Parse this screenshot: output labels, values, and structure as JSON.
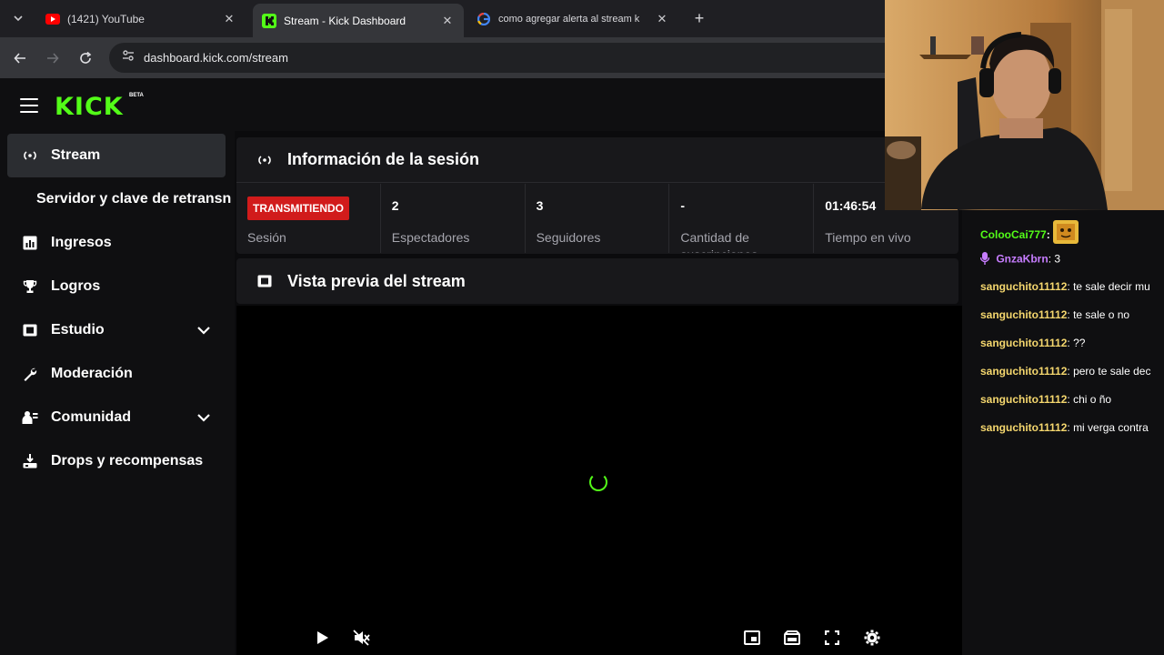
{
  "browser": {
    "tabs": [
      {
        "title": "(1421) YouTube",
        "icon": "youtube-icon",
        "active": false
      },
      {
        "title": "Stream - Kick Dashboard",
        "icon": "kick-icon",
        "active": true
      },
      {
        "title": "como agregar alerta al stream k",
        "icon": "google-icon",
        "active": false
      }
    ],
    "url": "dashboard.kick.com/stream"
  },
  "app": {
    "logo": "KICK",
    "logo_badge": "BETA"
  },
  "sidebar": {
    "items": [
      {
        "label": "Stream",
        "icon": "broadcast-icon"
      },
      {
        "label": "Ingresos",
        "icon": "chart-icon"
      },
      {
        "label": "Logros",
        "icon": "trophy-icon"
      },
      {
        "label": "Estudio",
        "icon": "studio-icon"
      },
      {
        "label": "Moderación",
        "icon": "wrench-icon"
      },
      {
        "label": "Comunidad",
        "icon": "community-icon"
      },
      {
        "label": "Drops y recompensas",
        "icon": "drops-icon"
      }
    ],
    "sub_item": "Servidor y clave de retransn"
  },
  "session": {
    "title": "Información de la sesión",
    "status_badge": "TRANSMITIENDO",
    "stats": [
      {
        "value": "",
        "label": "Sesión"
      },
      {
        "value": "2",
        "label": "Espectadores"
      },
      {
        "value": "3",
        "label": "Seguidores"
      },
      {
        "value": "-",
        "label": "Cantidad de suscripciones"
      },
      {
        "value": "01:46:54",
        "label": "Tiempo en vivo"
      }
    ]
  },
  "preview": {
    "title": "Vista previa del stream"
  },
  "chat": {
    "messages": [
      {
        "user": "ColooCai777",
        "text": "",
        "color": "#53fc18"
      },
      {
        "user": "GnzaKbrn",
        "text": "3",
        "color": "#c77dff"
      },
      {
        "user": "sanguchito11112",
        "text": "te sale decir mu",
        "color": "#f5d76e"
      },
      {
        "user": "sanguchito11112",
        "text": "te sale o no",
        "color": "#f5d76e"
      },
      {
        "user": "sanguchito11112",
        "text": "??",
        "color": "#f5d76e"
      },
      {
        "user": "sanguchito11112",
        "text": "pero te sale dec",
        "color": "#f5d76e"
      },
      {
        "user": "sanguchito11112",
        "text": "chi o ño",
        "color": "#f5d76e"
      },
      {
        "user": "sanguchito11112",
        "text": "mi verga contra",
        "color": "#f5d76e"
      }
    ]
  },
  "colors": {
    "accent": "#53fc18",
    "live_badge": "#d11b1b"
  }
}
